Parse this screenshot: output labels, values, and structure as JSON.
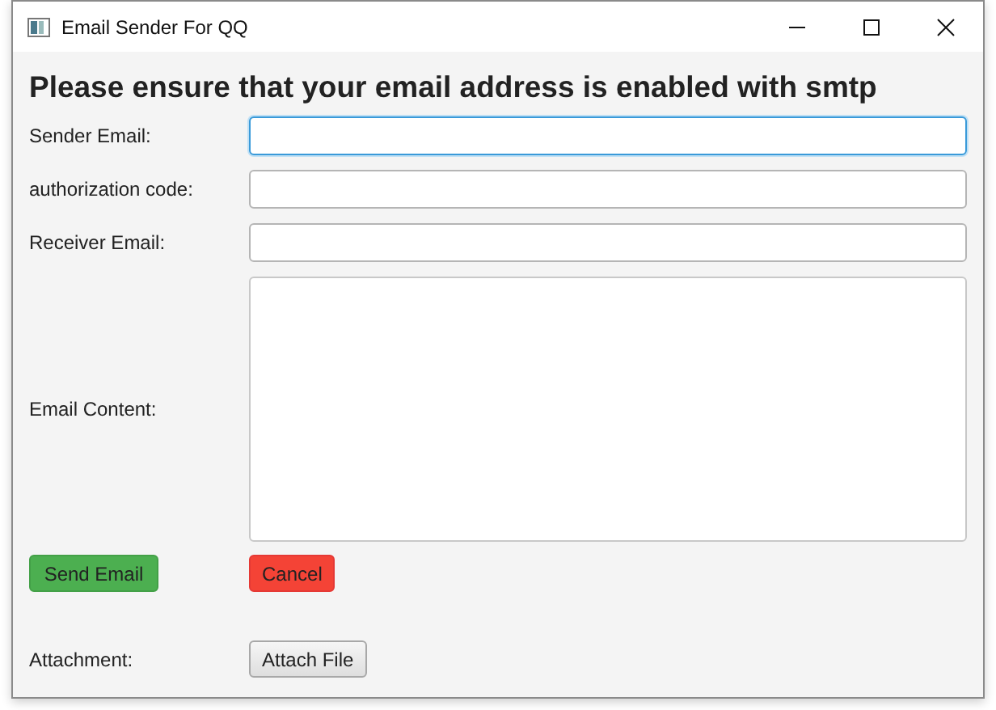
{
  "window": {
    "title": "Email Sender For QQ"
  },
  "heading": "Please ensure that your email address is enabled with smtp",
  "fields": [
    {
      "label": "Sender Email:",
      "kind": "text",
      "focused": true
    },
    {
      "label": "authorization code:",
      "kind": "text",
      "focused": false
    },
    {
      "label": "Receiver Email:",
      "kind": "text",
      "focused": false
    },
    {
      "label": "Email Content:",
      "kind": "textarea",
      "focused": false
    }
  ],
  "actions": [
    {
      "label": "Send Email",
      "kind": "success"
    },
    {
      "label": "Cancel",
      "kind": "danger"
    }
  ],
  "attachment": {
    "label": "Attachment:",
    "button": "Attach File"
  }
}
